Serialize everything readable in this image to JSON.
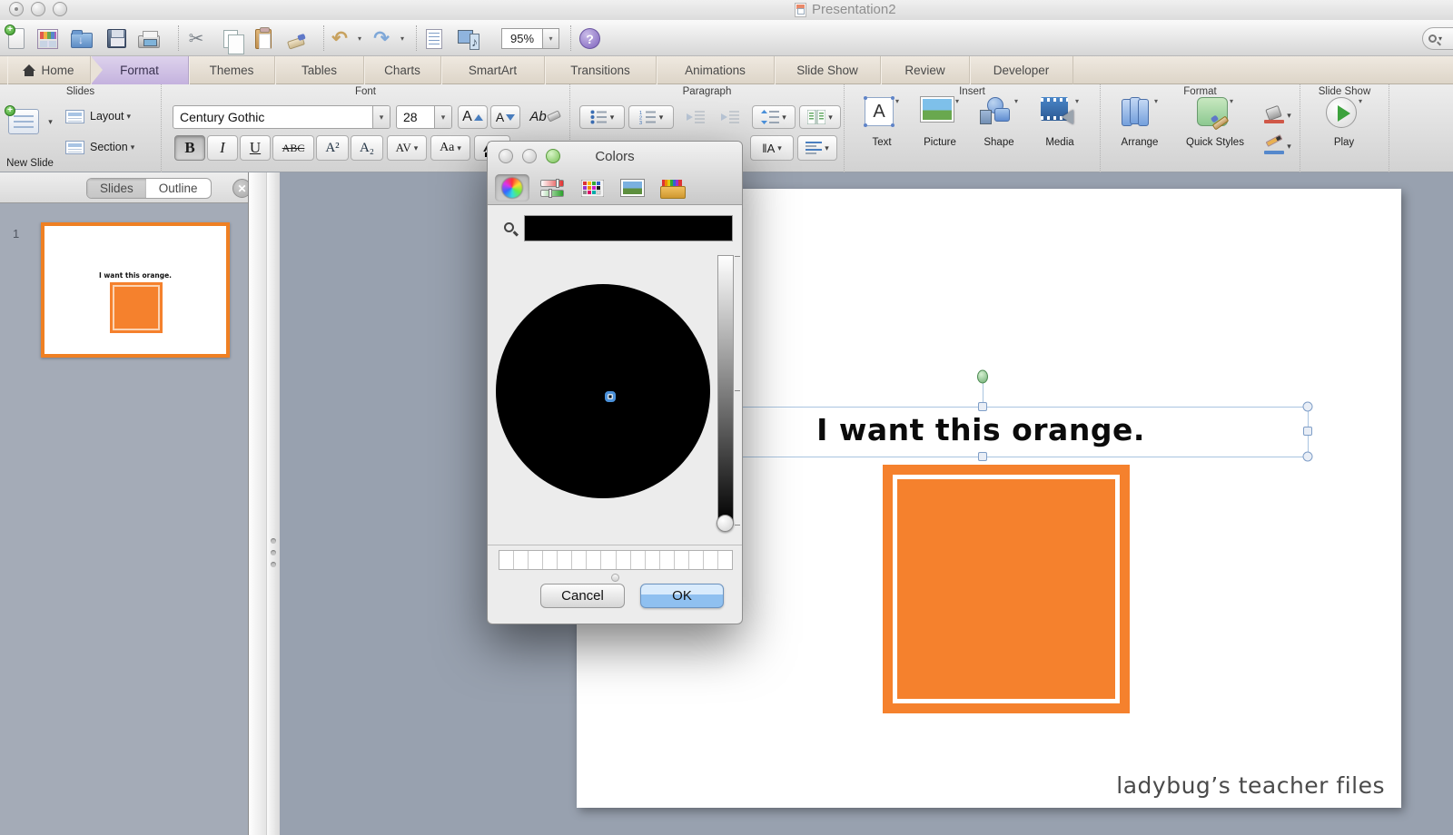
{
  "window": {
    "title": "Presentation2"
  },
  "toolbar": {
    "zoom": "95%",
    "help": "?",
    "icons": [
      "new-presentation-icon",
      "slide-gallery-icon",
      "open-icon",
      "save-icon",
      "print-icon",
      "cut-icon",
      "copy-icon",
      "paste-icon",
      "format-painter-icon",
      "undo-icon",
      "redo-icon",
      "formatting-palette-icon",
      "media-browser-icon",
      "zoom-dropdown",
      "help-icon",
      "search-icon"
    ]
  },
  "tabs": [
    {
      "label": "Home"
    },
    {
      "label": "Format"
    },
    {
      "label": "Themes"
    },
    {
      "label": "Tables"
    },
    {
      "label": "Charts"
    },
    {
      "label": "SmartArt"
    },
    {
      "label": "Transitions"
    },
    {
      "label": "Animations"
    },
    {
      "label": "Slide Show"
    },
    {
      "label": "Review"
    },
    {
      "label": "Developer"
    }
  ],
  "ribbon": {
    "groups": {
      "slides": "Slides",
      "font": "Font",
      "paragraph": "Paragraph",
      "insert": "Insert",
      "format": "Format",
      "slide_show": "Slide Show"
    },
    "slides": {
      "new_slide": "New Slide",
      "layout": "Layout",
      "section": "Section"
    },
    "font": {
      "name": "Century Gothic",
      "size": "28",
      "grow": "A",
      "shrink": "A",
      "clear": "Ab",
      "bold": "B",
      "italic": "I",
      "underline": "U",
      "strikethrough": "ABC",
      "superscript": "A²",
      "subscript": "A₂",
      "spacing": "AV",
      "change_case": "Aa",
      "font_color": "A",
      "text_direction": "‖A"
    },
    "insert": {
      "text": "Text",
      "picture": "Picture",
      "shape": "Shape",
      "media": "Media"
    },
    "format": {
      "arrange": "Arrange",
      "quick_styles": "Quick Styles"
    },
    "slide_show": {
      "play": "Play"
    }
  },
  "sidebar": {
    "tabs": [
      {
        "label": "Slides"
      },
      {
        "label": "Outline"
      }
    ],
    "slide_number": "1",
    "thumbnail_text": "I want this orange."
  },
  "dialog": {
    "title": "Colors",
    "cancel": "Cancel",
    "ok": "OK",
    "selected_color": "#000000",
    "wheel_color": "#000000",
    "brightness": "0",
    "swatch_count": 16,
    "tools": [
      "color-wheel-icon",
      "color-sliders-icon",
      "color-palettes-icon",
      "image-palettes-icon",
      "crayons-icon"
    ]
  },
  "slide": {
    "text": "I want this orange.",
    "credit": "ladybug’s teacher files"
  },
  "colors": {
    "accent_orange": "#F5812D",
    "active_tab_purple": "#CDBCE4",
    "ok_button_blue": "#8FC0F0",
    "selection_blue": "#A9C4E0",
    "sidebar_bg": "#A4ABB7",
    "canvas_bg": "#98A1AF"
  }
}
